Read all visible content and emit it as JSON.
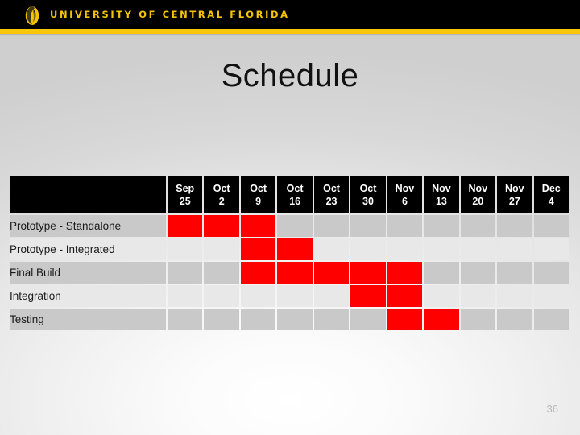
{
  "banner": {
    "institution": "UNIVERSITY OF CENTRAL FLORIDA",
    "logo_icon": "pegasus-logo-icon",
    "bar_color": "#000000",
    "accent_color": "#f7c708",
    "text_color": "#f5c400"
  },
  "slide": {
    "title": "Schedule",
    "page_number": "36",
    "background_color": "#e6e6e6"
  },
  "chart_data": {
    "type": "table",
    "title": "Schedule",
    "xlabel": "",
    "ylabel": "",
    "legend": [],
    "grid": true,
    "corner_header": "",
    "categories": [
      "Sep 25",
      "Oct 2",
      "Oct 9",
      "Oct 16",
      "Oct 23",
      "Oct 30",
      "Nov 6",
      "Nov 13",
      "Nov 20",
      "Nov 27",
      "Dec 4"
    ],
    "column_headers": [
      {
        "month": "Sep",
        "day": "25"
      },
      {
        "month": "Oct",
        "day": "2"
      },
      {
        "month": "Oct",
        "day": "9"
      },
      {
        "month": "Oct",
        "day": "16"
      },
      {
        "month": "Oct",
        "day": "23"
      },
      {
        "month": "Oct",
        "day": "30"
      },
      {
        "month": "Nov",
        "day": "6"
      },
      {
        "month": "Nov",
        "day": "13"
      },
      {
        "month": "Nov",
        "day": "20"
      },
      {
        "month": "Nov",
        "day": "27"
      },
      {
        "month": "Dec",
        "day": "4"
      }
    ],
    "rows": [
      {
        "label": "Prototype - Standalone",
        "band": "dark",
        "cells": [
          1,
          1,
          1,
          0,
          0,
          0,
          0,
          0,
          0,
          0,
          0
        ]
      },
      {
        "label": "Prototype - Integrated",
        "band": "light",
        "cells": [
          0,
          0,
          1,
          1,
          0,
          0,
          0,
          0,
          0,
          0,
          0
        ]
      },
      {
        "label": "Final Build",
        "band": "dark",
        "cells": [
          0,
          0,
          1,
          1,
          1,
          1,
          1,
          0,
          0,
          0,
          0
        ]
      },
      {
        "label": "Integration",
        "band": "light",
        "cells": [
          0,
          0,
          0,
          0,
          0,
          1,
          1,
          0,
          0,
          0,
          0
        ]
      },
      {
        "label": "Testing",
        "band": "dark",
        "cells": [
          0,
          0,
          0,
          0,
          0,
          0,
          1,
          1,
          0,
          0,
          0
        ]
      }
    ],
    "fill_color": "#ff0000",
    "header_background": "#000000",
    "header_text_color": "#ffffff",
    "band_dark_color": "#c9c9c9",
    "band_light_color": "#e8e8e8"
  }
}
